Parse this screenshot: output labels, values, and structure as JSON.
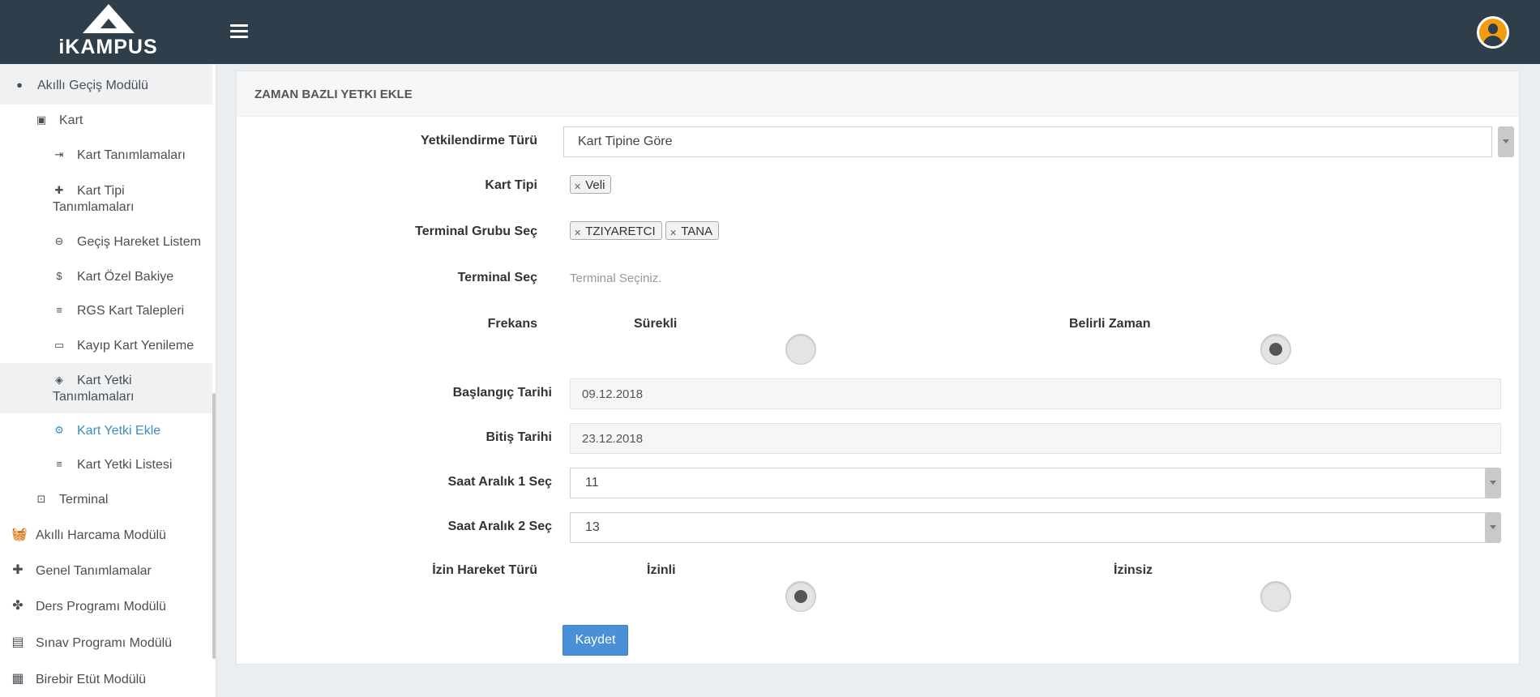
{
  "app": {
    "logo_text": "iKAMPUS"
  },
  "header": {
    "menu_icon": "hamburger-icon",
    "avatar_icon": "user-avatar-icon"
  },
  "sidebar": {
    "module": {
      "label": "Akıllı Geçiş Modülü",
      "icon": "compass-icon"
    },
    "kart": {
      "label": "Kart",
      "icon": "card-icon"
    },
    "kart_tanimlamalari": "Kart Tanımlamaları",
    "kart_tipi_1": "Kart Tipi",
    "kart_tipi_2": "Tanımlamaları",
    "gecis_hareket": "Geçiş Hareket Listem",
    "kart_ozel_bakiye": "Kart Özel Bakiye",
    "rgs_kart": "RGS Kart Talepleri",
    "kayip_kart": "Kayıp Kart Yenileme",
    "kart_yetki_1": "Kart Yetki",
    "kart_yetki_2": "Tanımlamaları",
    "kart_yetki_ekle": "Kart Yetki Ekle",
    "kart_yetki_listesi": "Kart Yetki Listesi",
    "terminal": "Terminal",
    "harcama": "Akıllı Harcama Modülü",
    "genel": "Genel Tanımlamalar",
    "ders": "Ders Programı Modülü",
    "sinav": "Sınav Programı Modülü",
    "birebir": "Birebir Etüt Modülü"
  },
  "form": {
    "title": "ZAMAN BAZLI YETKI EKLE",
    "yetki_turu": {
      "label": "Yetkilendirme Türü",
      "value": "Kart Tipine Göre"
    },
    "kart_tipi": {
      "label": "Kart Tipi",
      "tags": [
        "Veli"
      ]
    },
    "terminal_grubu": {
      "label": "Terminal Grubu Seç",
      "tags": [
        "TZIYARETCI",
        "TANA"
      ]
    },
    "terminal": {
      "label": "Terminal Seç",
      "placeholder": "Terminal Seçiniz."
    },
    "frekans": {
      "label": "Frekans",
      "opt1": "Sürekli",
      "opt2": "Belirli Zaman",
      "selected": "Belirli Zaman"
    },
    "baslangic": {
      "label": "Başlangıç Tarihi",
      "value": "09.12.2018"
    },
    "bitis": {
      "label": "Bitiş Tarihi",
      "value": "23.12.2018"
    },
    "saat1": {
      "label": "Saat Aralık 1 Seç",
      "value": "11"
    },
    "saat2": {
      "label": "Saat Aralık 2 Seç",
      "value": "13"
    },
    "izin": {
      "label": "İzin Hareket Türü",
      "opt1": "İzinli",
      "opt2": "İzinsiz",
      "selected": "İzinli"
    },
    "save_label": "Kaydet"
  }
}
